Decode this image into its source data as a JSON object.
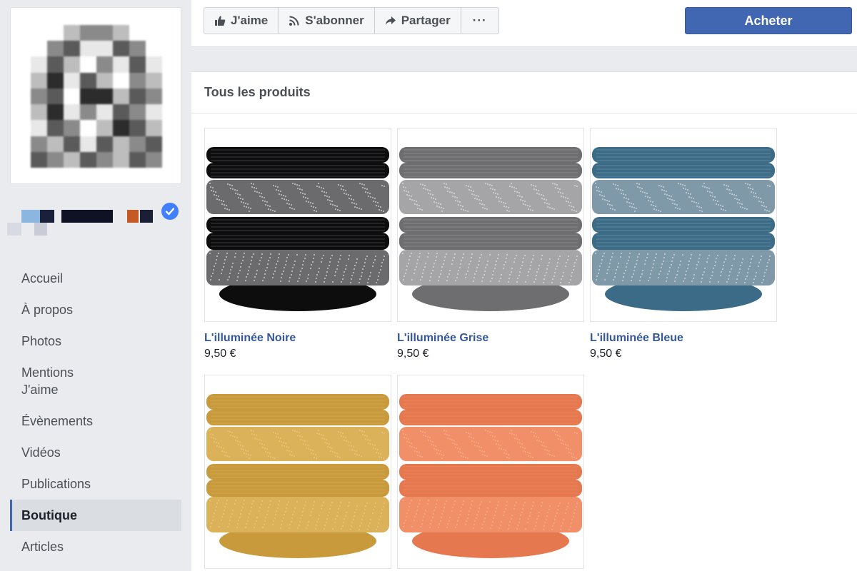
{
  "topbar": {
    "buttons": [
      {
        "label": "J'aime",
        "icon": "thumbs-up-icon"
      },
      {
        "label": "S'abonner",
        "icon": "rss-icon"
      },
      {
        "label": "Partager",
        "icon": "share-arrow-icon"
      },
      {
        "label": "···",
        "icon": "more-icon"
      }
    ],
    "buy_label": "Acheter"
  },
  "sidebar": {
    "items": [
      {
        "label": "Accueil"
      },
      {
        "label": "À propos"
      },
      {
        "label": "Photos"
      },
      {
        "label": "Mentions J'aime"
      },
      {
        "label": "Évènements"
      },
      {
        "label": "Vidéos"
      },
      {
        "label": "Publications"
      },
      {
        "label": "Boutique",
        "active": true
      },
      {
        "label": "Articles"
      }
    ]
  },
  "shop": {
    "title": "Tous les produits",
    "products": [
      {
        "name": "L'illuminée Noire",
        "price": "9,50 €",
        "colors": {
          "dark": "#0d0d0e",
          "light": "#6b6b6e",
          "sparkle": "#c9c9cc"
        }
      },
      {
        "name": "L'illuminée Grise",
        "price": "9,50 €",
        "colors": {
          "dark": "#6e6e70",
          "light": "#a5a5a7",
          "sparkle": "#d8d8da"
        }
      },
      {
        "name": "L'illuminée Bleue",
        "price": "9,50 €",
        "colors": {
          "dark": "#3b6b86",
          "light": "#7f99a8",
          "sparkle": "#c7d3da"
        }
      },
      {
        "name": "",
        "price": "",
        "colors": {
          "dark": "#c89a3c",
          "light": "#dbb15a",
          "sparkle": "#e8c67a"
        }
      },
      {
        "name": "",
        "price": "",
        "colors": {
          "dark": "#e6784f",
          "light": "#f08f68",
          "sparkle": "#f5ab8a"
        }
      }
    ]
  },
  "colors": {
    "accent": "#4267b2",
    "link": "#365899",
    "verified": "#4080ff"
  }
}
